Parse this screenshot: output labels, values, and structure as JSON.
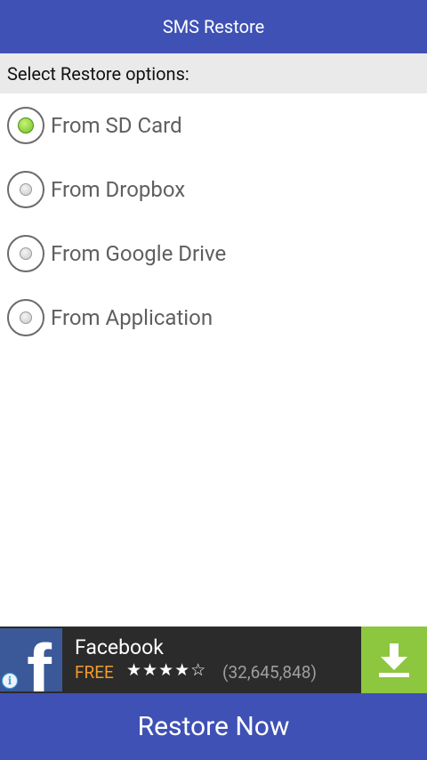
{
  "header": {
    "title": "SMS Restore"
  },
  "section": {
    "label": "Select Restore options:"
  },
  "options": [
    {
      "label": "From SD Card",
      "checked": true
    },
    {
      "label": "From Dropbox",
      "checked": false
    },
    {
      "label": "From Google Drive",
      "checked": false
    },
    {
      "label": "From Application",
      "checked": false
    }
  ],
  "ad": {
    "app_name": "Facebook",
    "price": "FREE",
    "stars": "★★★★☆",
    "rating": 4,
    "reviews": "(32,645,848)",
    "info_glyph": "i",
    "logo_glyph": "f"
  },
  "footer": {
    "button_label": "Restore Now"
  },
  "colors": {
    "primary": "#3f51b5",
    "radio_selected": "#6fc21f",
    "ad_download": "#8dc63f",
    "ad_price": "#f39b2a"
  }
}
